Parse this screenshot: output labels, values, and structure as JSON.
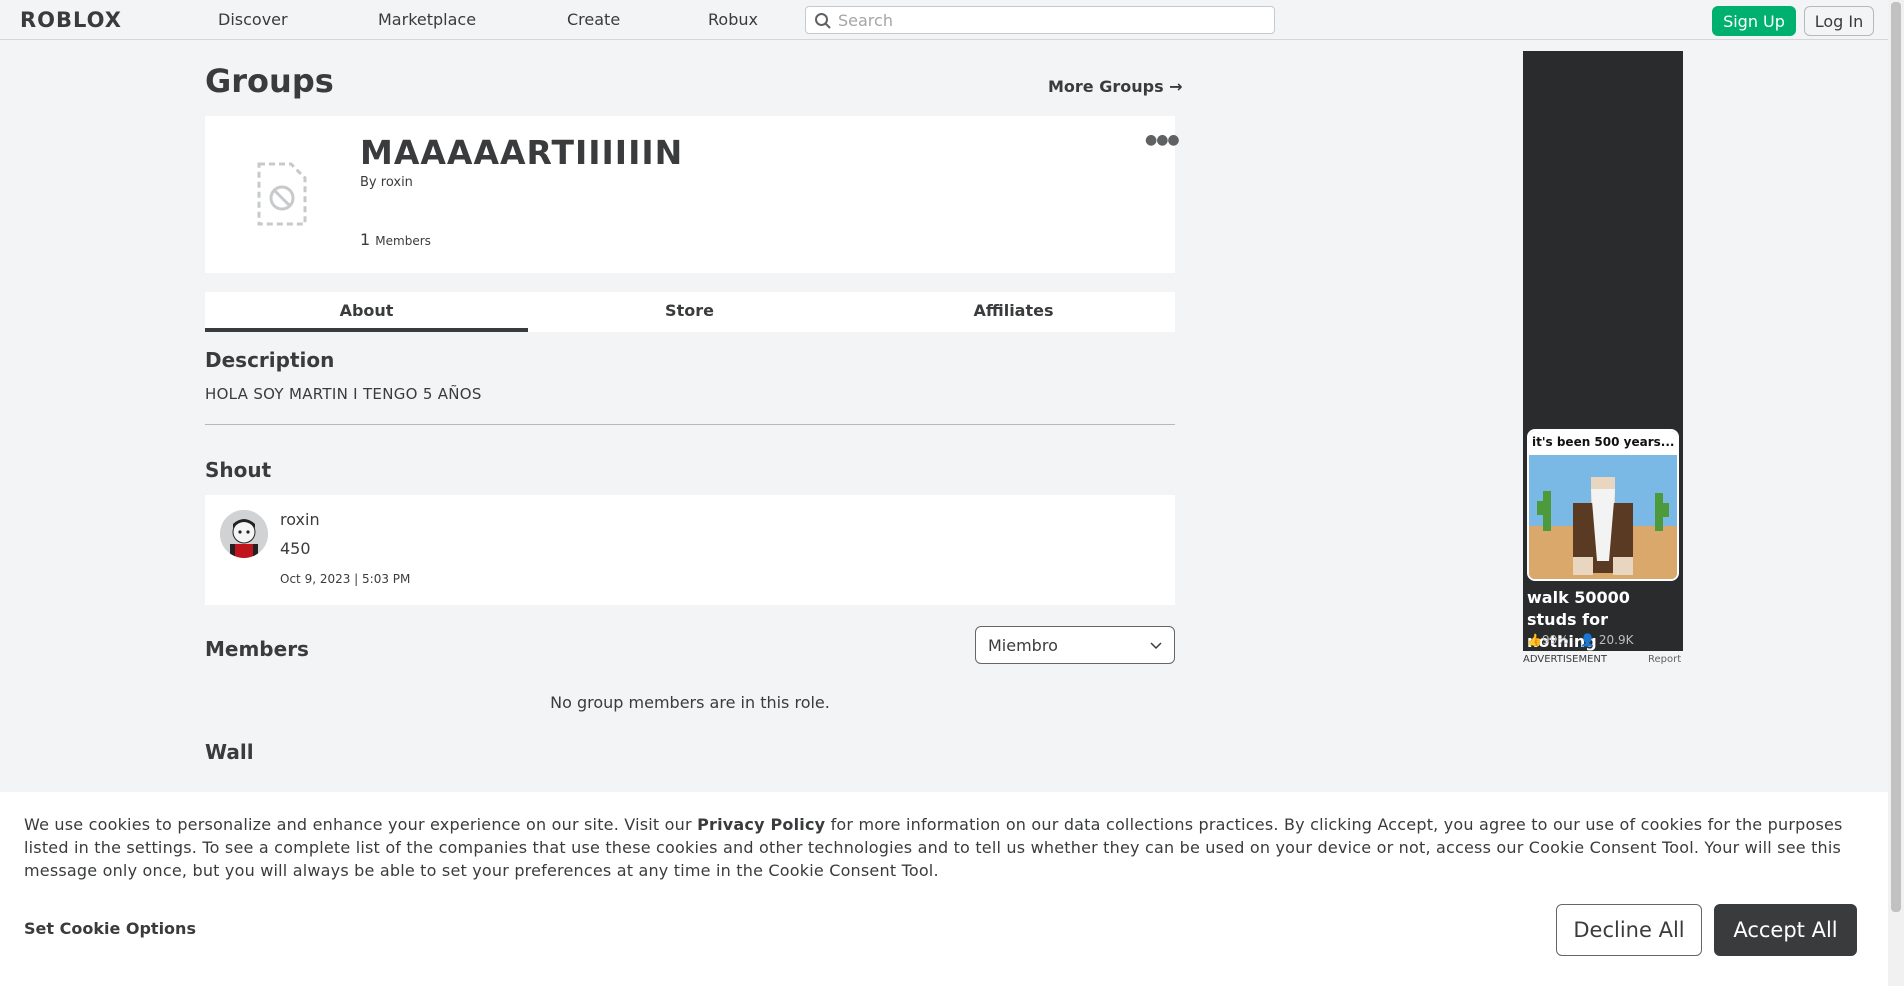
{
  "nav": {
    "logo": "ROBLOX",
    "links": [
      "Discover",
      "Marketplace",
      "Create",
      "Robux"
    ],
    "search_placeholder": "Search",
    "signup_label": "Sign Up",
    "login_label": "Log In"
  },
  "page": {
    "title": "Groups",
    "more_groups": "More Groups →"
  },
  "group": {
    "name": "MAAAAARTIIIIIIN",
    "by_prefix": "By",
    "owner": "roxin",
    "member_count": "1",
    "members_label": "Members",
    "menu_icon": "ellipsis-icon"
  },
  "tabs": [
    "About",
    "Store",
    "Affiliates"
  ],
  "about": {
    "description_title": "Description",
    "description": "HOLA SOY MARTIN I TENGO 5 AÑOS",
    "shout_title": "Shout",
    "shout": {
      "user": "roxin",
      "body": "450",
      "timestamp": "Oct 9, 2023 | 5:03 PM"
    },
    "members_title": "Members",
    "role_selected": "Miembro",
    "no_members": "No group members are in this role.",
    "wall_title": "Wall"
  },
  "ad": {
    "thumb_text": "it's been 500 years...",
    "caption": "walk 50000 studs for nothing",
    "rating": "99%",
    "players": "20.9K",
    "label": "ADVERTISEMENT",
    "report": "Report"
  },
  "cookie": {
    "text_part1": "We use cookies to personalize and enhance your experience on our site. Visit our ",
    "privacy_link": "Privacy Policy",
    "text_part2": " for more information on our data collections practices. By clicking Accept, you agree to our use of cookies for the purposes listed in the settings. To see a complete list of the companies that use these cookies and other technologies and to tell us whether they can be used on your device or not, access our Cookie Consent Tool. Your will see this message only once, but you will always be able to set your preferences at any time in the Cookie Consent Tool.",
    "set_options": "Set Cookie Options",
    "decline": "Decline All",
    "accept": "Accept All"
  },
  "colors": {
    "accent_green": "#00b06f",
    "text": "#393b3d",
    "background": "#f2f4f5"
  }
}
